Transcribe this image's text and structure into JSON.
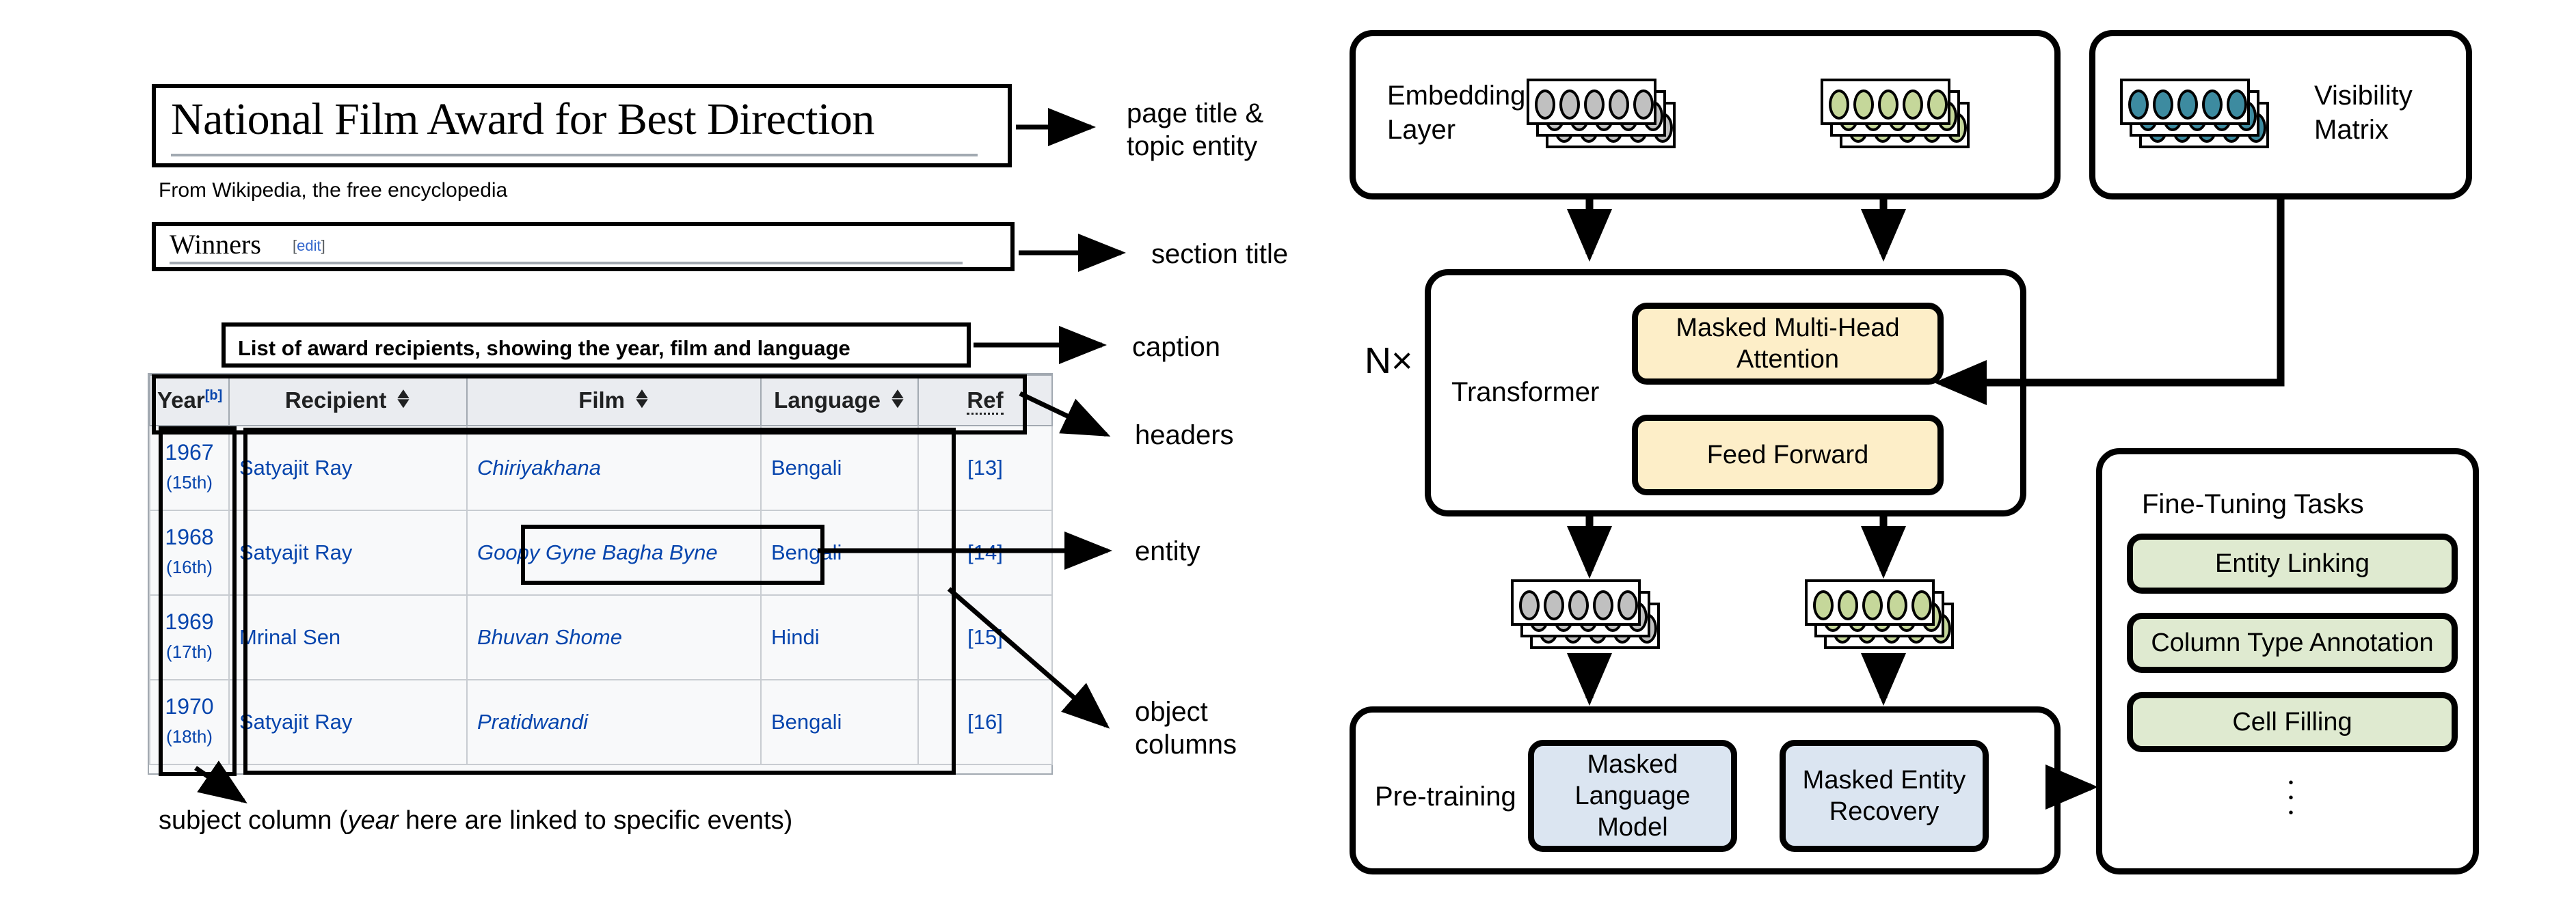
{
  "left": {
    "page_title": "National Film Award for Best Direction",
    "tagline": "From Wikipedia, the free encyclopedia",
    "section_title": "Winners",
    "section_edit": "edit",
    "caption": "List of award recipients, showing the year, film and language",
    "table": {
      "headers": [
        "Year",
        "Recipient",
        "Film",
        "Language",
        "Ref"
      ],
      "year_header_sup": "[b]",
      "rows": [
        {
          "year": "1967",
          "edition": "(15th)",
          "recipient": "Satyajit Ray",
          "film": "Chiriyakhana",
          "language": "Bengali",
          "ref": "[13]"
        },
        {
          "year": "1968",
          "edition": "(16th)",
          "recipient": "Satyajit Ray",
          "film": "Goopy Gyne Bagha Byne",
          "language": "Bengali",
          "ref": "[14]"
        },
        {
          "year": "1969",
          "edition": "(17th)",
          "recipient": "Mrinal Sen",
          "film": "Bhuvan Shome",
          "language": "Hindi",
          "ref": "[15]"
        },
        {
          "year": "1970",
          "edition": "(18th)",
          "recipient": "Satyajit Ray",
          "film": "Pratidwandi",
          "language": "Bengali",
          "ref": "[16]"
        }
      ]
    },
    "subject_caption_pre": "subject column (",
    "subject_caption_em": "year",
    "subject_caption_post": " here are linked to specific events)",
    "annotations": {
      "page_title": "page title &\ntopic entity",
      "section_title": "section title",
      "caption": "caption",
      "headers": "headers",
      "entity": "entity",
      "object_columns": "object\ncolumns"
    }
  },
  "right": {
    "embedding_layer_label": "Embedding\nLayer",
    "visibility_matrix_label": "Visibility\nMatrix",
    "transformer_label": "Transformer",
    "n_times_label": "N×",
    "attention_label": "Masked Multi-Head\nAttention",
    "feed_forward_label": "Feed Forward",
    "pretraining_label": "Pre-training",
    "mlm_label": "Masked Language\nModel",
    "mer_label": "Masked Entity\nRecovery",
    "finetuning_label": "Fine-Tuning Tasks",
    "finetuning_tasks": [
      "Entity Linking",
      "Column Type Annotation",
      "Cell Filling"
    ],
    "more_tasks_indicator": "⋮",
    "colors": {
      "token_gray": "#c0c0c0",
      "token_green": "#c5d79a",
      "token_teal": "#3d8ba0",
      "attention_fill": "#fdeec8",
      "pretrain_fill": "#dbe5f1",
      "finetune_fill": "#dfead0",
      "outline": "#000000"
    },
    "token_counts": {
      "per_row": 5,
      "stack_depth": 3
    }
  }
}
